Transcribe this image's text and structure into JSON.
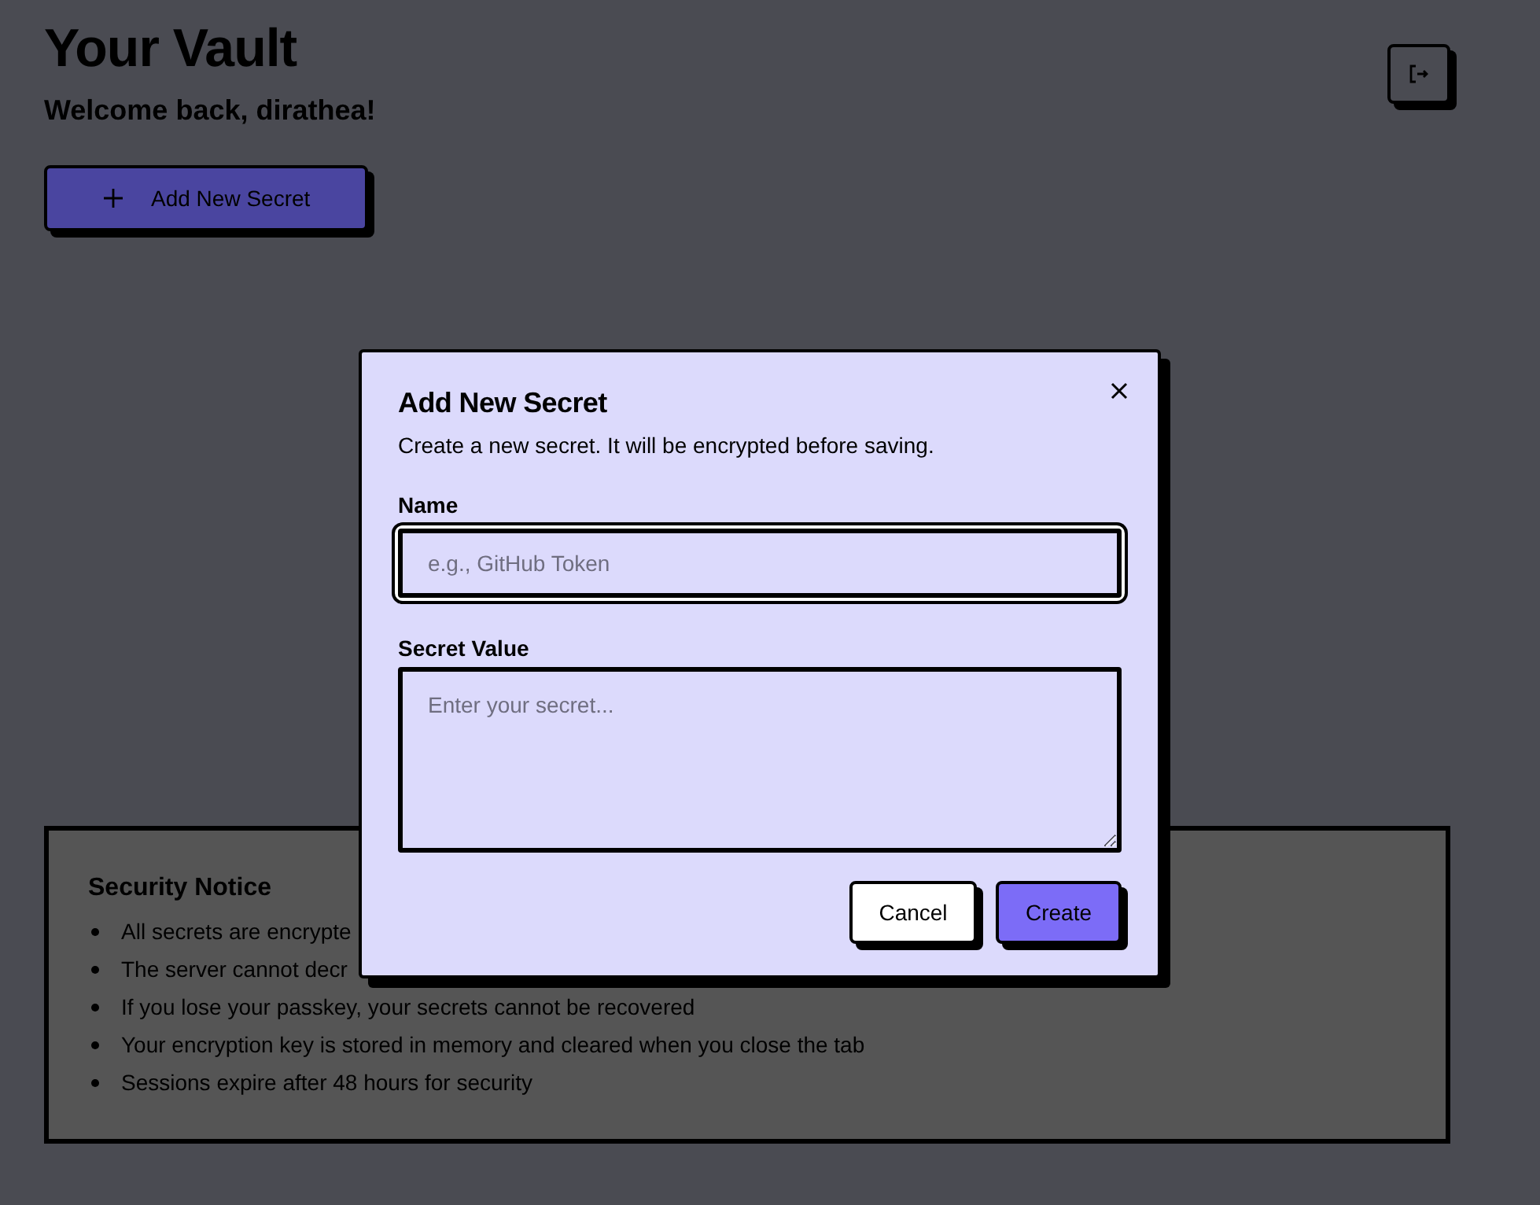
{
  "header": {
    "title": "Your Vault",
    "welcome": "Welcome back, dirathea!"
  },
  "add_button": {
    "label": "Add New Secret"
  },
  "security_notice": {
    "title": "Security Notice",
    "items": [
      "All secrets are encrypte",
      "The server cannot decr",
      "If you lose your passkey, your secrets cannot be recovered",
      "Your encryption key is stored in memory and cleared when you close the tab",
      "Sessions expire after 48 hours for security"
    ]
  },
  "dialog": {
    "title": "Add New Secret",
    "description": "Create a new secret. It will be encrypted before saving.",
    "fields": [
      {
        "kind": "input",
        "label": "Name",
        "placeholder": "e.g., GitHub Token",
        "focused": true
      },
      {
        "kind": "textarea",
        "label": "Secret Value",
        "placeholder": "Enter your secret...",
        "focused": false
      }
    ],
    "buttons": [
      {
        "label": "Cancel",
        "kind": "secondary"
      },
      {
        "label": "Create",
        "kind": "primary"
      }
    ]
  }
}
